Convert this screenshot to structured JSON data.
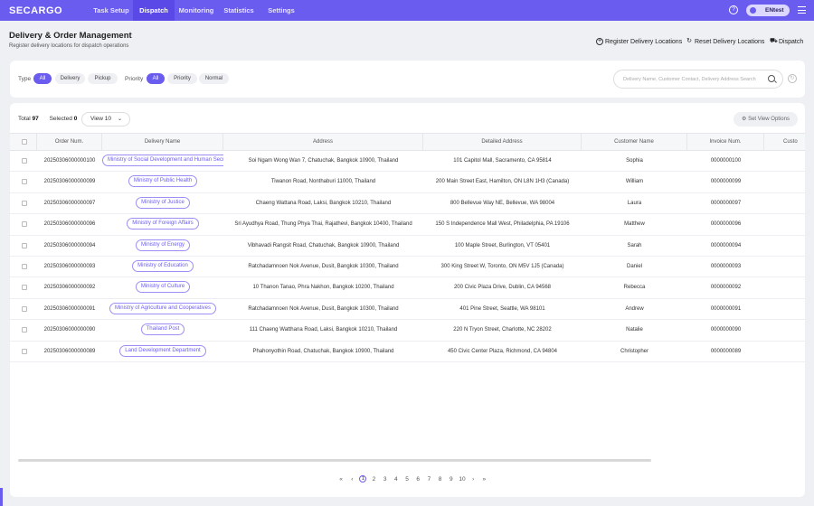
{
  "nav": {
    "logo": "SECARGO",
    "tabs": [
      {
        "label": "Task Setup"
      },
      {
        "label": "Dispatch"
      },
      {
        "label": "Monitoring"
      },
      {
        "label": "Statistics"
      },
      {
        "label": "Settings"
      }
    ],
    "active_tab": "Dispatch",
    "help": "?",
    "user": "ENtest"
  },
  "header": {
    "title": "Delivery & Order Management",
    "subtitle": "Register delivery locations for dispatch operations",
    "buttons": {
      "register": "Register Delivery Locations",
      "reset": "Reset Delivery Locations",
      "dispatch": "Dispatch"
    }
  },
  "filters": {
    "type_label": "Type",
    "type_options": [
      "All",
      "Delivery",
      "Pickup"
    ],
    "priority_label": "Priority",
    "priority_options": [
      "All",
      "Priority",
      "Normal"
    ],
    "search_placeholder": "Delivery Name, Customer Contact, Delivery Address Search"
  },
  "table_info": {
    "total_label": "Total",
    "total": "97",
    "selected_label": "Selected",
    "selected": "0",
    "view": "View 10",
    "view_options": "Set View Options"
  },
  "columns": [
    "Order Num.",
    "Delivery Name",
    "Address",
    "Detailed Address",
    "Customer Name",
    "Invoice Num.",
    "Custo"
  ],
  "rows": [
    {
      "order": "20250306000000100",
      "name": "Ministry of Social Development and Human Security",
      "address": "Soi Ngam Wong Wan 7, Chatuchak, Bangkok 10900, Thailand",
      "detail": "101 Capitol Mall, Sacramento, CA 95814",
      "customer": "Sophia",
      "invoice": "0000000100"
    },
    {
      "order": "20250306000000099",
      "name": "Ministry of Public Health",
      "address": "Tiwanon Road, Nonthaburi 11000, Thailand",
      "detail": "200 Main Street East, Hamilton, ON L8N 1H3 (Canada)",
      "customer": "William",
      "invoice": "0000000099"
    },
    {
      "order": "20250306000000097",
      "name": "Ministry of Justice",
      "address": "Chaeng Wattana Road, Laksi, Bangkok 10210, Thailand",
      "detail": "800 Bellevue Way NE, Bellevue, WA 98004",
      "customer": "Laura",
      "invoice": "0000000097"
    },
    {
      "order": "20250306000000096",
      "name": "Ministry of Foreign Affairs",
      "address": "Sri Ayudhya Road, Thung Phya Thai, Rajathevi, Bangkok 10400, Thailand",
      "detail": "150 S Independence Mall West, Philadelphia, PA 19106",
      "customer": "Matthew",
      "invoice": "0000000096"
    },
    {
      "order": "20250306000000094",
      "name": "Ministry of Energy",
      "address": "Vibhavadi Rangsit Road, Chatuchak, Bangkok 10900, Thailand",
      "detail": "100 Maple Street, Burlington, VT 05401",
      "customer": "Sarah",
      "invoice": "0000000094"
    },
    {
      "order": "20250306000000093",
      "name": "Ministry of Education",
      "address": "Ratchadamnoen Nok Avenue, Dusit, Bangkok 10300, Thailand",
      "detail": "300 King Street W, Toronto, ON M5V 1J5 (Canada)",
      "customer": "Daniel",
      "invoice": "0000000093"
    },
    {
      "order": "20250306000000092",
      "name": "Ministry of Culture",
      "address": "10 Thanon Tanao, Phra Nakhon, Bangkok 10200, Thailand",
      "detail": "200 Civic Plaza Drive, Dublin, CA 94568",
      "customer": "Rebecca",
      "invoice": "0000000092"
    },
    {
      "order": "20250306000000091",
      "name": "Ministry of Agriculture and Cooperatives",
      "address": "Ratchadamnoen Nok Avenue, Dusit, Bangkok 10300, Thailand",
      "detail": "401 Pine Street, Seattle, WA 98101",
      "customer": "Andrew",
      "invoice": "0000000091"
    },
    {
      "order": "20250306000000090",
      "name": "Thailand Post",
      "address": "111 Chaeng Watthana Road, Laksi, Bangkok 10210, Thailand",
      "detail": "220 N Tryon Street, Charlotte, NC 28202",
      "customer": "Natalie",
      "invoice": "0000000090"
    },
    {
      "order": "20250306000000089",
      "name": "Land Development Department",
      "address": "Phahonyothin Road, Chatuchak, Bangkok 10900, Thailand",
      "detail": "450 Civic Center Plaza, Richmond, CA 94804",
      "customer": "Christopher",
      "invoice": "0000000089"
    }
  ],
  "pagination": {
    "first": "«",
    "prev": "‹",
    "pages": [
      "1",
      "2",
      "3",
      "4",
      "5",
      "6",
      "7",
      "8",
      "9",
      "10"
    ],
    "current": "1",
    "next": "›",
    "last": "»"
  },
  "colors": {
    "accent": "#6b5cf0"
  }
}
